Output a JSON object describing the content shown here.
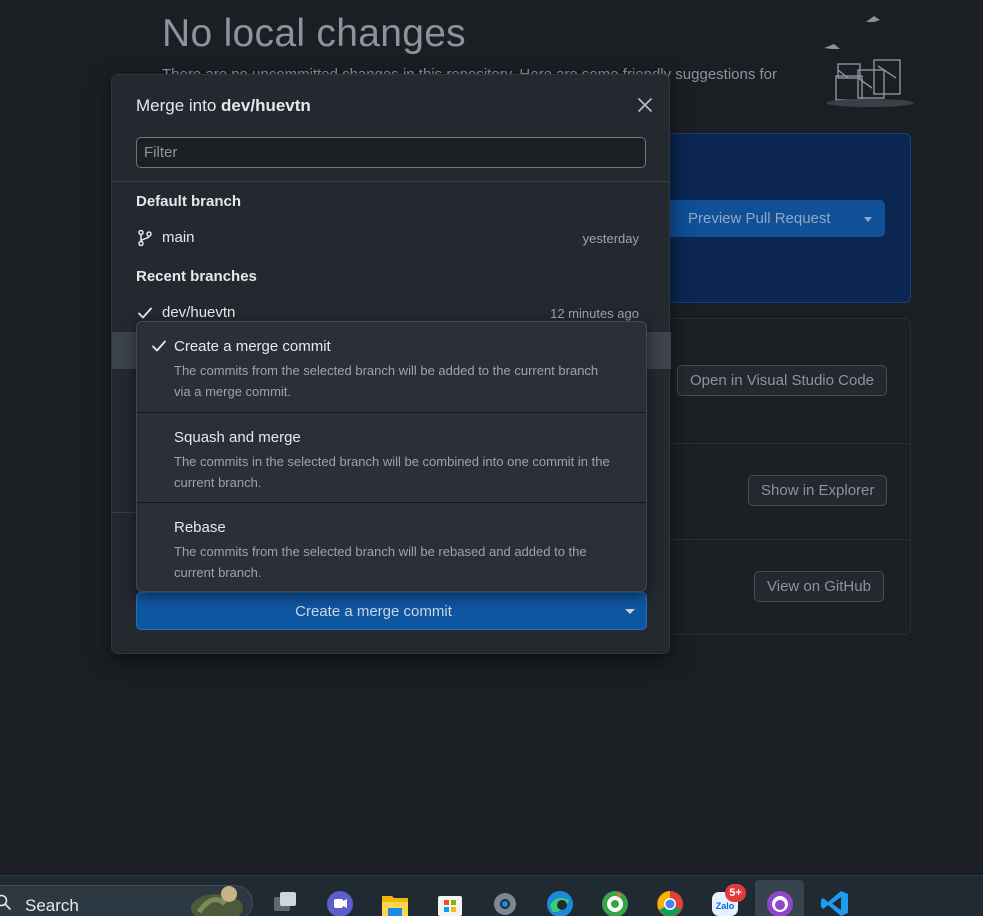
{
  "background": {
    "title": "No local changes",
    "subtitle": "There are no uncommitted changes in this repository. Here are some friendly suggestions for",
    "preview_pr_label": "Preview Pull Request",
    "open_vscode_label": "Open in Visual Studio Code",
    "show_explorer_label": "Show in Explorer",
    "view_github_label": "View on GitHub"
  },
  "dialog": {
    "title_prefix": "Merge into ",
    "title_branch": "dev/huevtn",
    "filter_placeholder": "Filter",
    "default_section": "Default branch",
    "default_branch": {
      "name": "main",
      "time": "yesterday"
    },
    "recent_section": "Recent branches",
    "recent_branch": {
      "name": "dev/huevtn",
      "time": "12 minutes ago"
    },
    "merge_button_label": "Create a merge commit"
  },
  "merge_menu": {
    "items": [
      {
        "title": "Create a merge commit",
        "description": "The commits from the selected branch will be added to the current branch via a merge commit.",
        "selected": true
      },
      {
        "title": "Squash and merge",
        "description": "The commits in the selected branch will be combined into one commit in the current branch.",
        "selected": false
      },
      {
        "title": "Rebase",
        "description": "The commits from the selected branch will be rebased and added to the current branch.",
        "selected": false
      }
    ]
  },
  "taskbar": {
    "search_label": "Search",
    "zalo_badge": "5+",
    "icons": [
      "task-view-icon",
      "teams-icon",
      "file-explorer-icon",
      "microsoft-store-icon",
      "settings-icon",
      "edge-icon",
      "coccoc-icon",
      "chrome-icon",
      "zalo-icon",
      "github-desktop-icon",
      "vscode-icon"
    ]
  },
  "colors": {
    "background": "#1b1e23",
    "dialog": "#24292f",
    "primary_button": "#0f56a1",
    "badge": "#e23b3b"
  }
}
